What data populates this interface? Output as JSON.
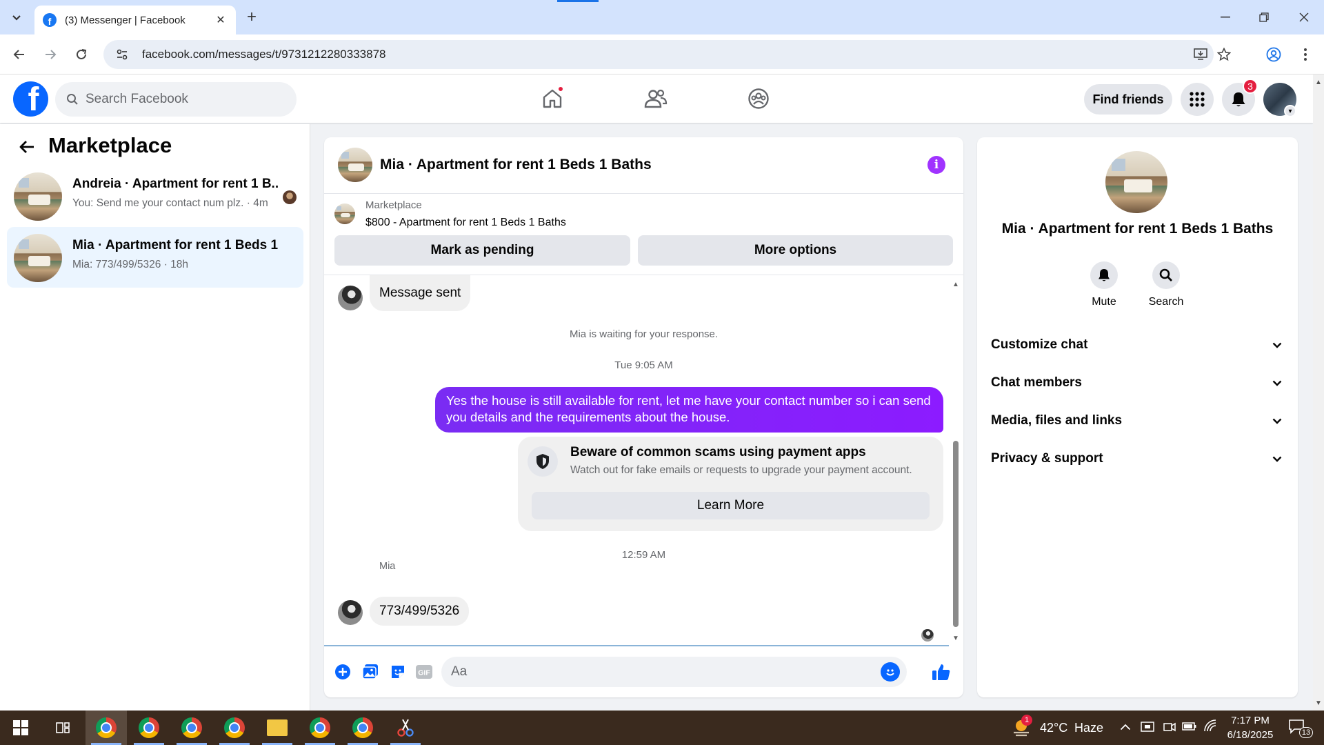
{
  "browser": {
    "tab_title": "(3) Messenger | Facebook",
    "url": "facebook.com/messages/t/9731212280333878"
  },
  "fb_header": {
    "search_placeholder": "Search Facebook",
    "find_friends": "Find friends",
    "notification_count": "3"
  },
  "left_pane": {
    "title": "Marketplace",
    "chats": [
      {
        "name": "Andreia · Apartment for rent 1 B...",
        "preview": "You: Send me your contact num plz. · 4m"
      },
      {
        "name": "Mia · Apartment for rent 1 Beds 1 ...",
        "preview": "Mia: 773/499/5326 · 18h"
      }
    ]
  },
  "conversation": {
    "title": "Mia · Apartment for rent 1 Beds 1 Baths",
    "listing_label": "Marketplace",
    "listing_price": "$800 - Apartment for rent 1 Beds 1 Baths",
    "mark_pending": "Mark as pending",
    "more_options": "More options",
    "messages": {
      "message_sent": "Message sent",
      "waiting": "Mia is waiting for your response.",
      "time1": "Tue 9:05 AM",
      "outgoing": "Yes the house is still available for rent, let me have your contact number so i can send you details and the requirements about the house.",
      "scam_title": "Beware of common scams using payment apps",
      "scam_sub": "Watch out for fake emails or requests to upgrade your payment account.",
      "learn_more": "Learn More",
      "time2": "12:59 AM",
      "sender": "Mia",
      "incoming": "773/499/5326"
    },
    "composer_placeholder": "Aa"
  },
  "right_pane": {
    "title": "Mia · Apartment for rent 1 Beds 1 Baths",
    "mute": "Mute",
    "search": "Search",
    "sections": [
      "Customize chat",
      "Chat members",
      "Media, files and links",
      "Privacy & support"
    ]
  },
  "taskbar": {
    "temperature": "42°C",
    "weather": "Haze",
    "weather_badge": "1",
    "time": "7:17 PM",
    "date": "6/18/2025",
    "notification_count": "13"
  },
  "colors": {
    "fb_blue": "#0866ff",
    "outgoing_bubble": "#7a2cf3",
    "info_icon": "#a033ff"
  }
}
